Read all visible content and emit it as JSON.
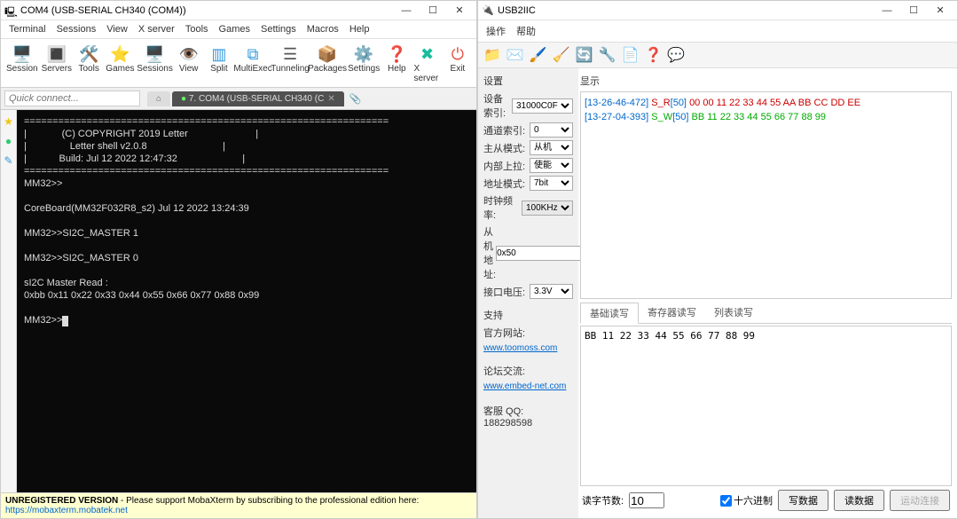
{
  "left": {
    "title": "COM4  (USB-SERIAL CH340 (COM4))",
    "menu": [
      "Terminal",
      "Sessions",
      "View",
      "X server",
      "Tools",
      "Games",
      "Settings",
      "Macros",
      "Help"
    ],
    "toolbar": [
      {
        "label": "Session",
        "icon": "🖥️",
        "color": "#3498db"
      },
      {
        "label": "Servers",
        "icon": "🔳",
        "color": "#555"
      },
      {
        "label": "Tools",
        "icon": "🛠️",
        "color": "#e74c3c"
      },
      {
        "label": "Games",
        "icon": "⭐",
        "color": "#f1c40f"
      },
      {
        "label": "Sessions",
        "icon": "🖥️",
        "color": "#3498db"
      },
      {
        "label": "View",
        "icon": "👁️",
        "color": "#888"
      },
      {
        "label": "Split",
        "icon": "▥",
        "color": "#3498db"
      },
      {
        "label": "MultiExec",
        "icon": "⧉",
        "color": "#3498db"
      },
      {
        "label": "Tunneling",
        "icon": "☰",
        "color": "#555"
      },
      {
        "label": "Packages",
        "icon": "📦",
        "color": "#d35400"
      },
      {
        "label": "Settings",
        "icon": "⚙️",
        "color": "#3498db"
      },
      {
        "label": "Help",
        "icon": "❓",
        "color": "#3498db"
      }
    ],
    "toolbar_right": [
      {
        "label": "X server",
        "icon": "✖",
        "color": "#1abc9c"
      },
      {
        "label": "Exit",
        "icon": "⏻",
        "color": "#e74c3c"
      }
    ],
    "quick_placeholder": "Quick connect...",
    "tab_home": "⌂",
    "tab_active": "7. COM4  (USB-SERIAL CH340 (C",
    "terminal": "================================================================\n|             (C) COPYRIGHT 2019 Letter                         |\n|                Letter shell v2.0.8                            |\n|            Build: Jul 12 2022 12:47:32                        |\n================================================================\nMM32>>\n\nCoreBoard(MM32F032R8_s2) Jul 12 2022 13:24:39\n\nMM32>>SI2C_MASTER 1\n\nMM32>>SI2C_MASTER 0\n\nsI2C Master Read :\n0xbb 0x11 0x22 0x33 0x44 0x55 0x66 0x77 0x88 0x99\n\nMM32>>",
    "footer_bold": "UNREGISTERED VERSION",
    "footer_text": " - Please support MobaXterm by subscribing to the professional edition here: ",
    "footer_link": "https://mobaxterm.mobatek.net"
  },
  "right": {
    "title": "USB2IIC",
    "menu": [
      "操作",
      "帮助"
    ],
    "icons": [
      "📁",
      "✉️",
      "🖌️",
      "🧹",
      "🔄",
      "🔧",
      "📄",
      "❓",
      "💬"
    ],
    "group_settings": "设置",
    "group_display": "显示",
    "form": {
      "dev_index": {
        "label": "设备索引:",
        "value": "31000C0F"
      },
      "ch_index": {
        "label": "通道索引:",
        "value": "0"
      },
      "master": {
        "label": "主从模式:",
        "value": "从机"
      },
      "pull": {
        "label": "内部上拉:",
        "value": "使能"
      },
      "addr_mode": {
        "label": "地址模式:",
        "value": "7bit"
      },
      "clock": {
        "label": "时钟频率:",
        "value": "100KHz"
      },
      "slave_addr": {
        "label": "从机地址:",
        "value": "0x50"
      },
      "voltage": {
        "label": "接口电压:",
        "value": "3.3V"
      }
    },
    "support": "支持",
    "site_label": "官方网站:",
    "site_link": "www.toomoss.com",
    "forum_label": "论坛交流:",
    "forum_link": "www.embed-net.com",
    "qq_label": "客服  QQ:",
    "qq_value": "188298598",
    "log": [
      {
        "ts": "[13-26-46-472]",
        "op": "S_R",
        "addr": "[50]",
        "data": "00 00 11 22 33 44 55 AA BB CC DD EE",
        "cls": "r"
      },
      {
        "ts": "[13-27-04-393]",
        "op": "S_W",
        "addr": "[50]",
        "data": "BB 11 22 33 44 55 66 77 88 99",
        "cls": "w"
      }
    ],
    "tabs": [
      "基础读写",
      "寄存器读写",
      "列表读写"
    ],
    "databox": "BB 11 22 33 44 55 66 77 88 99",
    "bytes_label": "读字节数:",
    "bytes_value": "10",
    "hex_label": "十六进制",
    "btn_write": "写数据",
    "btn_read": "读数据",
    "btn_conn": "运动连接"
  }
}
